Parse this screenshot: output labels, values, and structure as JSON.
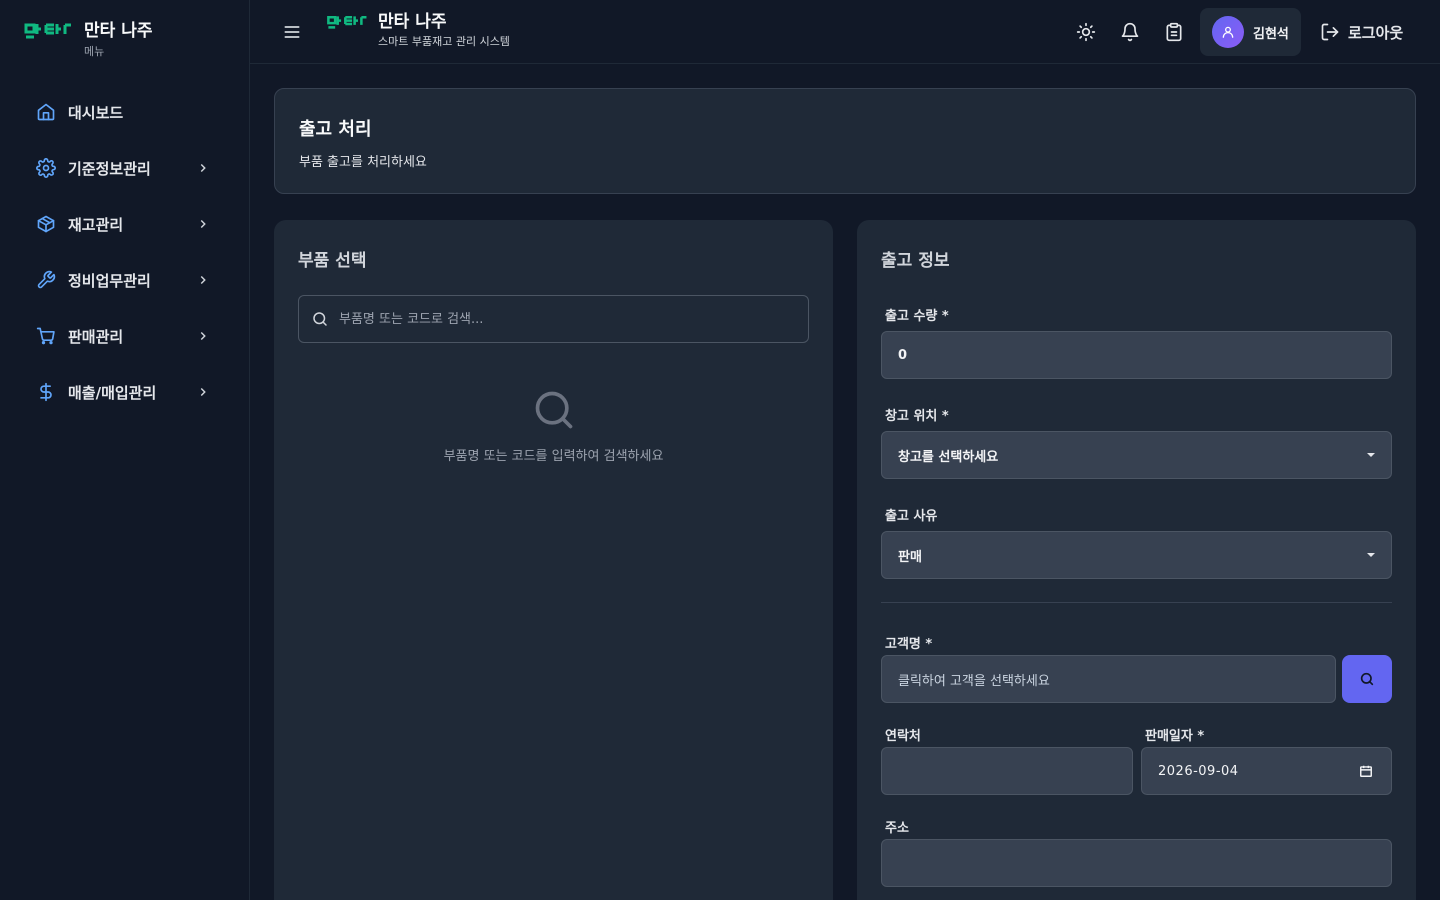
{
  "sidebar": {
    "logo": "ㅁㅏㅌㅏ",
    "logo_display": "마타",
    "title": "만타 나주",
    "subtitle": "메뉴",
    "items": [
      {
        "label": "대시보드",
        "icon": "home-icon",
        "has_children": false
      },
      {
        "label": "기준정보관리",
        "icon": "gear-icon",
        "has_children": true
      },
      {
        "label": "재고관리",
        "icon": "box-icon",
        "has_children": true
      },
      {
        "label": "정비업무관리",
        "icon": "wrench-icon",
        "has_children": true
      },
      {
        "label": "판매관리",
        "icon": "cart-icon",
        "has_children": true
      },
      {
        "label": "매출/매입관리",
        "icon": "dollar-icon",
        "has_children": true
      }
    ]
  },
  "header": {
    "title": "만타 나주",
    "subtitle": "스마트 부품재고 관리 시스템",
    "user_name": "김현석",
    "logout_label": "로그아웃"
  },
  "page": {
    "title": "출고 처리",
    "subtitle": "부품 출고를 처리하세요"
  },
  "part_select": {
    "title": "부품 선택",
    "search_placeholder": "부품명 또는 코드로 검색...",
    "empty_text": "부품명 또는 코드를 입력하여 검색하세요"
  },
  "out_info": {
    "title": "출고 정보",
    "quantity_label": "출고 수량 *",
    "quantity_value": "0",
    "warehouse_label": "창고 위치 *",
    "warehouse_value": "창고를 선택하세요",
    "reason_label": "출고 사유",
    "reason_value": "판매",
    "customer_label": "고객명 *",
    "customer_placeholder": "클릭하여 고객을 선택하세요",
    "contact_label": "연락처",
    "contact_value": "",
    "sale_date_label": "판매일자 *",
    "sale_date_value": "2026-09-04",
    "address_label": "주소",
    "address_value": ""
  },
  "colors": {
    "background": "#111827",
    "panel": "#1f2937",
    "input": "#374151",
    "accent": "#6366f1",
    "brand": "#10b981"
  }
}
